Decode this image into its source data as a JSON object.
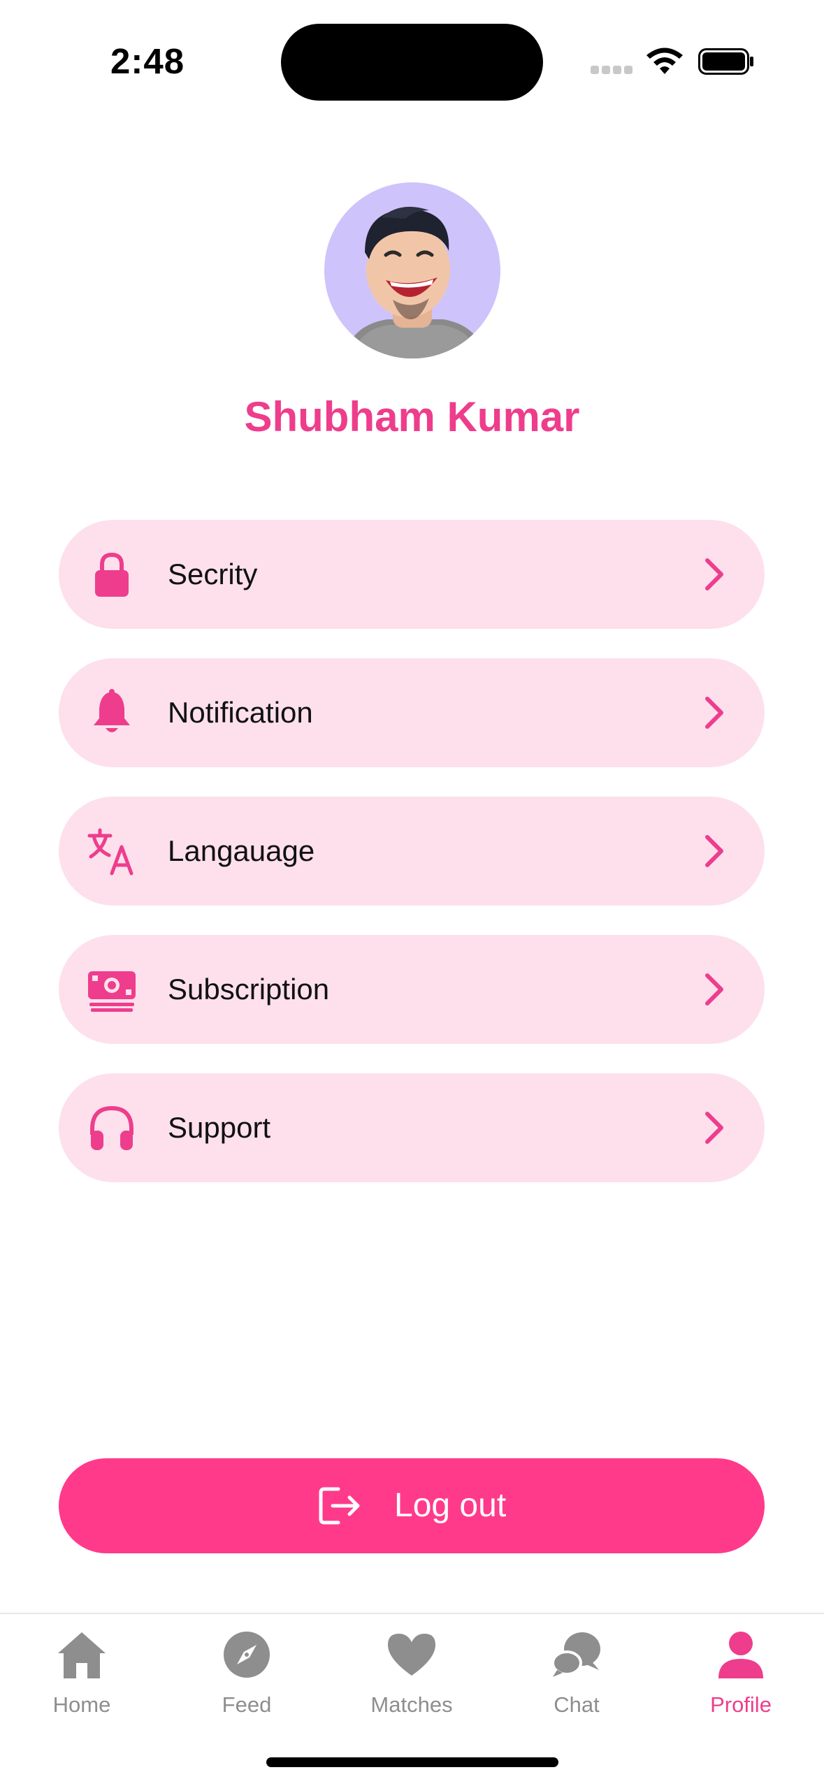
{
  "status_bar": {
    "time": "2:48"
  },
  "profile": {
    "name": "Shubham Kumar"
  },
  "menu": {
    "items": [
      {
        "label": "Secrity",
        "icon": "lock-icon"
      },
      {
        "label": "Notification",
        "icon": "bell-icon"
      },
      {
        "label": "Langauage",
        "icon": "translate-icon"
      },
      {
        "label": "Subscription",
        "icon": "money-icon"
      },
      {
        "label": "Support",
        "icon": "headphones-icon"
      }
    ]
  },
  "logout": {
    "label": "Log out"
  },
  "tabbar": {
    "tabs": [
      {
        "label": "Home",
        "icon": "home-icon",
        "active": false
      },
      {
        "label": "Feed",
        "icon": "compass-icon",
        "active": false
      },
      {
        "label": "Matches",
        "icon": "heart-icon",
        "active": false
      },
      {
        "label": "Chat",
        "icon": "chat-bubbles-icon",
        "active": false
      },
      {
        "label": "Profile",
        "icon": "person-icon",
        "active": true
      }
    ]
  },
  "colors": {
    "accent": "#ee3d8c",
    "button": "#ff3a8b",
    "menu_background": "#fde0ec",
    "avatar_background": "#cfc3fb",
    "tab_inactive": "#8e8e8e"
  }
}
